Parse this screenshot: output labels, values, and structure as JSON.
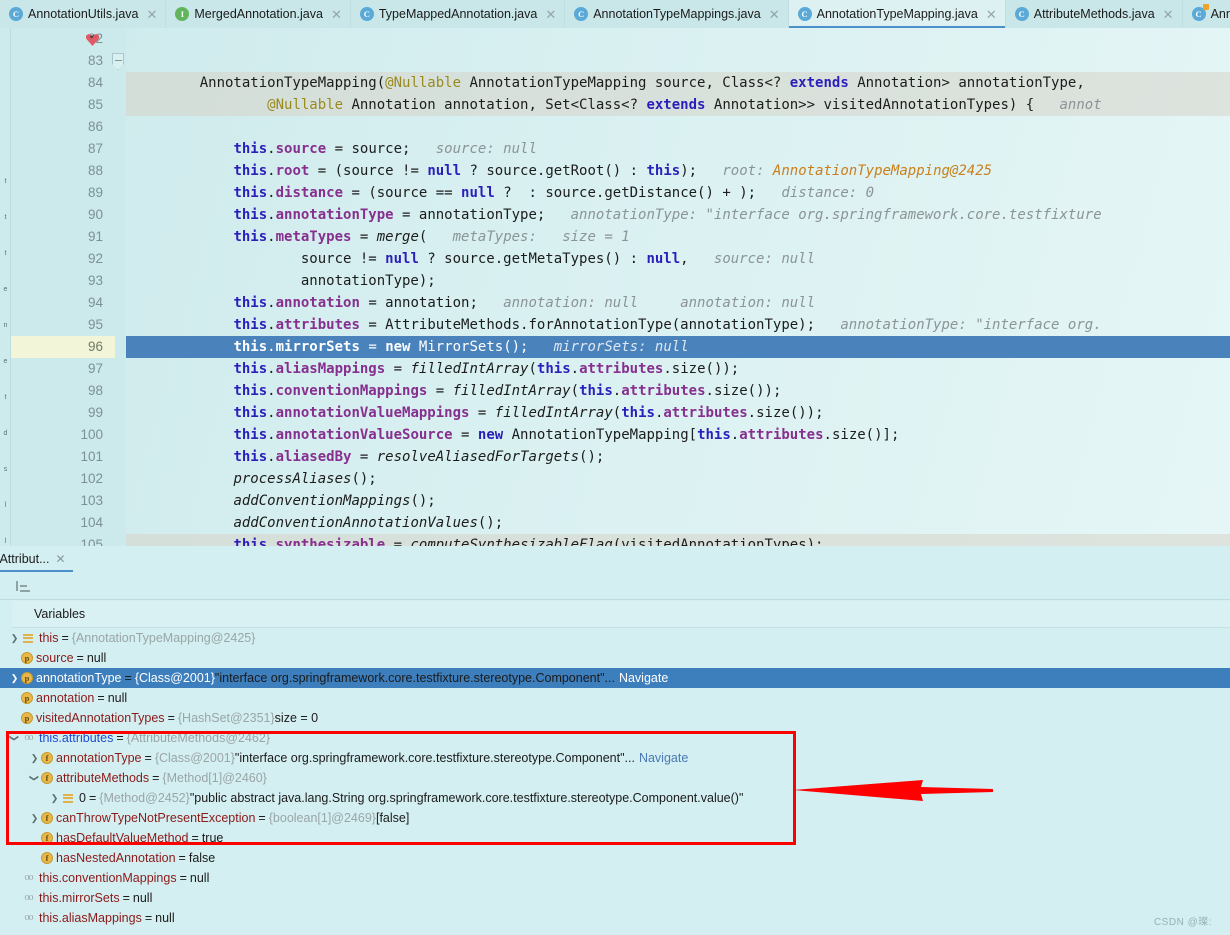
{
  "tabs": [
    {
      "label": "AnnotationUtils.java",
      "icon": "class-icon",
      "kind": "c",
      "active": false
    },
    {
      "label": "MergedAnnotation.java",
      "icon": "interface-icon",
      "kind": "i",
      "active": false
    },
    {
      "label": "TypeMappedAnnotation.java",
      "icon": "class-icon",
      "kind": "c",
      "active": false
    },
    {
      "label": "AnnotationTypeMappings.java",
      "icon": "class-icon",
      "kind": "c",
      "active": false
    },
    {
      "label": "AnnotationTypeMapping.java",
      "icon": "class-icon",
      "kind": "c",
      "active": true
    },
    {
      "label": "AttributeMethods.java",
      "icon": "class-icon",
      "kind": "c",
      "active": false
    },
    {
      "label": "Ann",
      "icon": "class-modified-icon",
      "kind": "ca",
      "active": false
    }
  ],
  "tab_close_glyph": "✕",
  "editor": {
    "first_line": 82,
    "current_line": 96,
    "breakpoint_line": 84,
    "lines": [
      {
        "n": 82,
        "code": ""
      },
      {
        "n": 83,
        "code": ""
      },
      {
        "n": 84,
        "code": "    AnnotationTypeMapping(@Nullable AnnotationTypeMapping source, Class<? extends Annotation> annotationType,",
        "declaration": true
      },
      {
        "n": 85,
        "code": "            @Nullable Annotation annotation, Set<Class<? extends Annotation>> visitedAnnotationTypes) {",
        "hint": "annot",
        "declaration": true
      },
      {
        "n": 86,
        "code": ""
      },
      {
        "n": 87,
        "code": "        this.source = source;",
        "hint": "source: null"
      },
      {
        "n": 88,
        "code": "        this.root = (source != null ? source.getRoot() : this);",
        "hint": "root: ",
        "hintv": "AnnotationTypeMapping@2425"
      },
      {
        "n": 89,
        "code": "        this.distance = (source == null ? 0 : source.getDistance() + 1);",
        "hint": "distance: 0"
      },
      {
        "n": 90,
        "code": "        this.annotationType = annotationType;",
        "hint": "annotationType: \"interface org.springframework.core.testfixture"
      },
      {
        "n": 91,
        "code": "        this.metaTypes = merge(",
        "hint": "metaTypes:   size = 1"
      },
      {
        "n": 92,
        "code": "                source != null ? source.getMetaTypes() : null,",
        "hint": "source: null"
      },
      {
        "n": 93,
        "code": "                annotationType);"
      },
      {
        "n": 94,
        "code": "        this.annotation = annotation;",
        "hint": "annotation: null     annotation: null"
      },
      {
        "n": 95,
        "code": "        this.attributes = AttributeMethods.forAnnotationType(annotationType);",
        "hint": "annotationType: \"interface org."
      },
      {
        "n": 96,
        "code": "        this.mirrorSets = new MirrorSets();",
        "hint": "mirrorSets: null",
        "current": true
      },
      {
        "n": 97,
        "code": "        this.aliasMappings = filledIntArray(this.attributes.size());"
      },
      {
        "n": 98,
        "code": "        this.conventionMappings = filledIntArray(this.attributes.size());"
      },
      {
        "n": 99,
        "code": "        this.annotationValueMappings = filledIntArray(this.attributes.size());"
      },
      {
        "n": 100,
        "code": "        this.annotationValueSource = new AnnotationTypeMapping[this.attributes.size()];"
      },
      {
        "n": 101,
        "code": "        this.aliasedBy = resolveAliasedForTargets();"
      },
      {
        "n": 102,
        "code": "        processAliases();"
      },
      {
        "n": 103,
        "code": "        addConventionMappings();"
      },
      {
        "n": 104,
        "code": "        addConventionAnnotationValues();"
      },
      {
        "n": 105,
        "code": "        this.synthesizable = computeSynthesizableFlag(visitedAnnotationTypes);",
        "declaration": true
      }
    ]
  },
  "debug_panel": {
    "tab_label": "tAttribut...",
    "tab_close_glyph": "✕",
    "toolbar_icon": "layout-settings-icon",
    "variables_header": "Variables",
    "rows": [
      {
        "indent": 0,
        "arrow": "collapsed",
        "icon": "object-icon",
        "name": "this",
        "eq": "=",
        "type": "{AnnotationTypeMapping@2425}",
        "value": "",
        "nav": "",
        "selected": false
      },
      {
        "indent": 0,
        "arrow": "none",
        "icon": "param-icon",
        "name": "source",
        "eq": "=",
        "type": "",
        "value": "null",
        "nav": "",
        "selected": false
      },
      {
        "indent": 0,
        "arrow": "collapsed",
        "icon": "param-icon",
        "name": "annotationType",
        "eq": "=",
        "type": "{Class@2001}",
        "value": "\"interface org.springframework.core.testfixture.stereotype.Component\"...",
        "nav": "Navigate",
        "selected": true
      },
      {
        "indent": 0,
        "arrow": "none",
        "icon": "param-icon",
        "name": "annotation",
        "eq": "=",
        "type": "",
        "value": "null",
        "nav": "",
        "selected": false
      },
      {
        "indent": 0,
        "arrow": "none",
        "icon": "param-icon",
        "name": "visitedAnnotationTypes",
        "eq": "=",
        "type": "{HashSet@2351}",
        "value": "size = 0",
        "nav": "",
        "selected": false
      },
      {
        "indent": 0,
        "arrow": "expanded",
        "icon": "field-ref-icon",
        "name": "this.attributes",
        "name_style": "blue",
        "eq": "=",
        "type": "{AttributeMethods@2462}",
        "value": "",
        "nav": "",
        "selected": false
      },
      {
        "indent": 1,
        "arrow": "collapsed",
        "icon": "field-icon",
        "name": "annotationType",
        "eq": "=",
        "type": "{Class@2001}",
        "value": "\"interface org.springframework.core.testfixture.stereotype.Component\"...",
        "nav": "Navigate",
        "selected": false
      },
      {
        "indent": 1,
        "arrow": "expanded",
        "icon": "field-icon",
        "name": "attributeMethods",
        "eq": "=",
        "type": "{Method[1]@2460}",
        "value": "",
        "nav": "",
        "selected": false
      },
      {
        "indent": 2,
        "arrow": "collapsed",
        "icon": "object-icon",
        "name": "0",
        "name_style": "plain",
        "eq": "=",
        "type": "{Method@2452}",
        "value": "\"public abstract java.lang.String org.springframework.core.testfixture.stereotype.Component.value()\"",
        "nav": "",
        "selected": false
      },
      {
        "indent": 1,
        "arrow": "collapsed",
        "icon": "field-icon",
        "name": "canThrowTypeNotPresentException",
        "eq": "=",
        "type": "{boolean[1]@2469}",
        "value": "[false]",
        "nav": "",
        "selected": false
      },
      {
        "indent": 1,
        "arrow": "none",
        "icon": "field-icon",
        "name": "hasDefaultValueMethod",
        "eq": "=",
        "type": "",
        "value": "true",
        "nav": "",
        "selected": false
      },
      {
        "indent": 1,
        "arrow": "none",
        "icon": "field-icon",
        "name": "hasNestedAnnotation",
        "eq": "=",
        "type": "",
        "value": "false",
        "nav": "",
        "selected": false
      },
      {
        "indent": 0,
        "arrow": "none",
        "icon": "field-ref-icon",
        "name": "this.conventionMappings",
        "eq": "=",
        "type": "",
        "value": "null",
        "nav": "",
        "selected": false
      },
      {
        "indent": 0,
        "arrow": "none",
        "icon": "field-ref-icon",
        "name": "this.mirrorSets",
        "eq": "=",
        "type": "",
        "value": "null",
        "nav": "",
        "selected": false
      },
      {
        "indent": 0,
        "arrow": "none",
        "icon": "field-ref-icon",
        "name": "this.aliasMappings",
        "eq": "=",
        "type": "",
        "value": "null",
        "nav": "",
        "selected": false
      }
    ]
  },
  "annotation": {
    "highlight_color": "#ff0000",
    "arrow_color": "#ff0000"
  },
  "watermark": "CSDN @璨:",
  "colors": {
    "editor_bg": "#d9f0f1",
    "current_line": "#4a82bb",
    "selection": "#3d7ebd",
    "accent": "#4b90c8",
    "keyword": "#2b1fbb",
    "field": "#862f8f",
    "annotation_token": "#9a8a1e",
    "hint": "#8b9496",
    "hint_value": "#c97f1a"
  }
}
